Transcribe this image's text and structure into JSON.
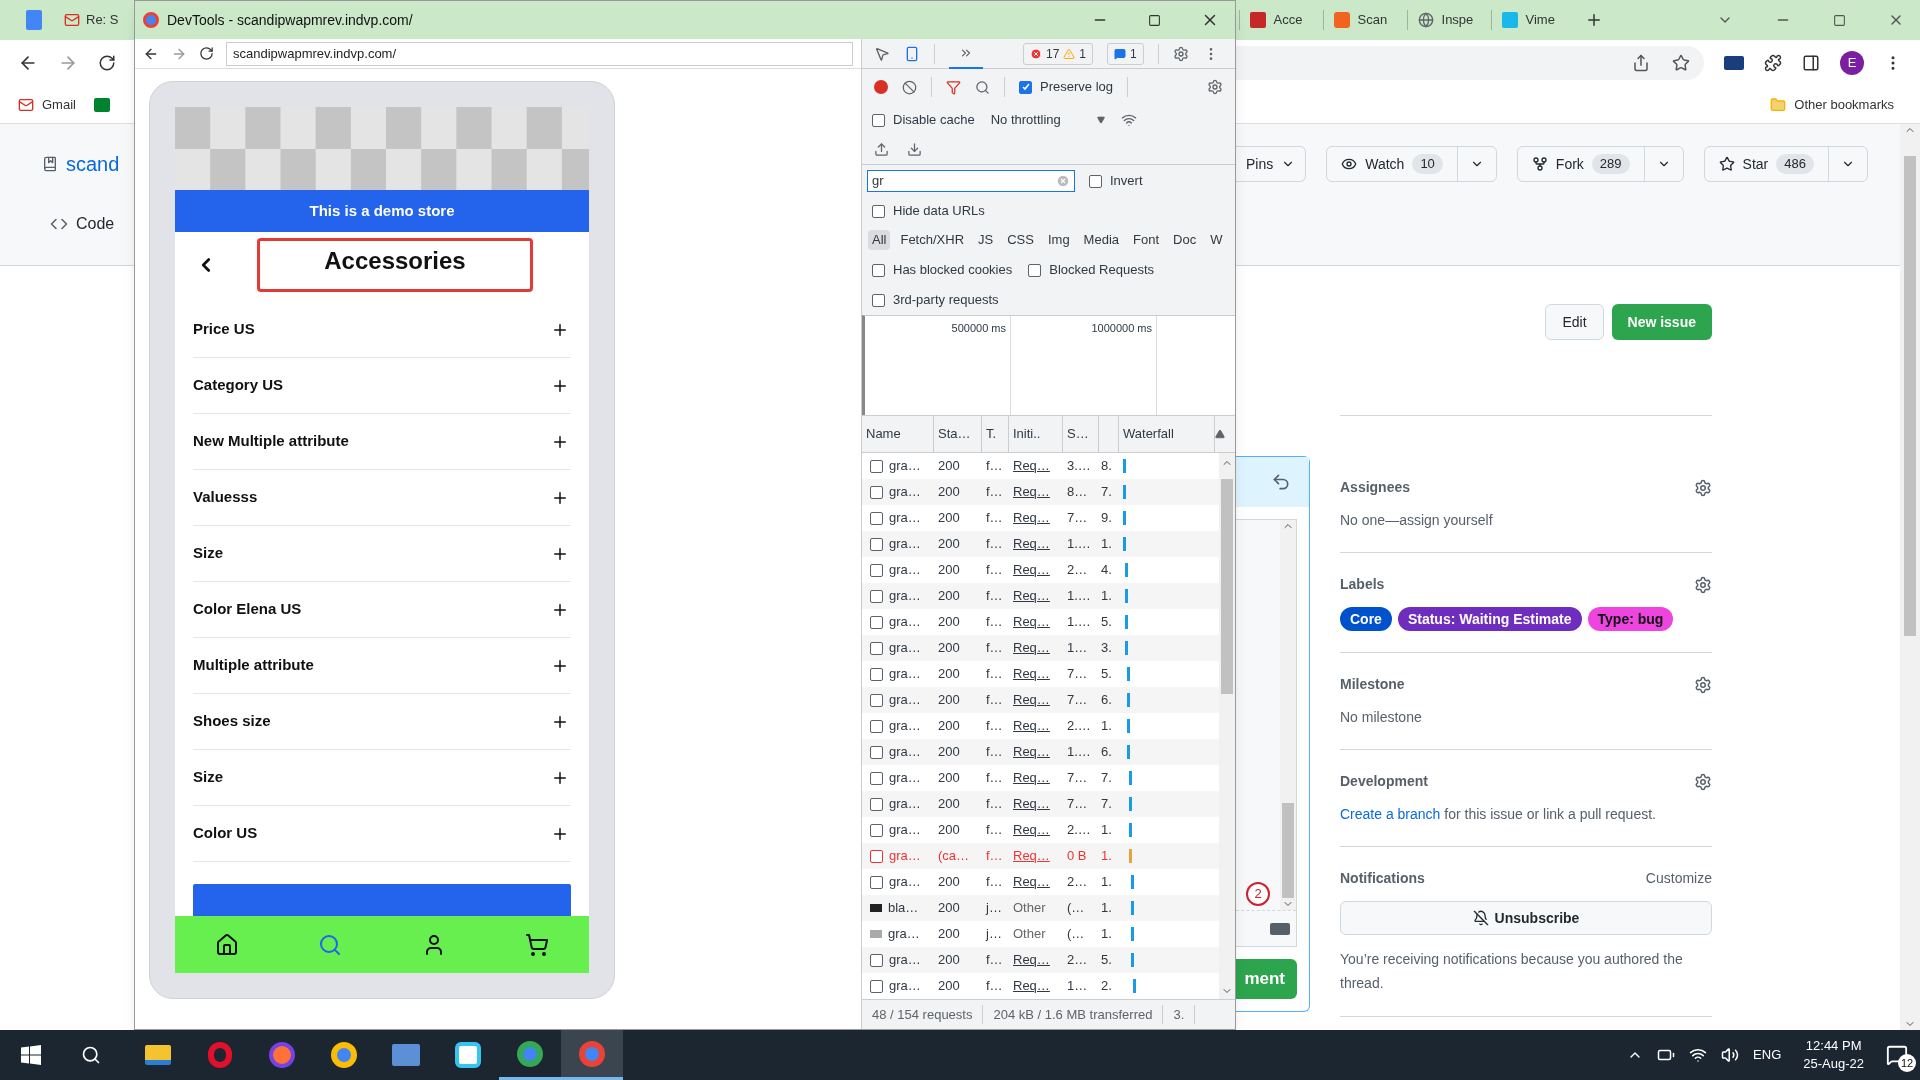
{
  "browser": {
    "left_tabs": [
      {
        "title": "Re: S"
      }
    ],
    "right_tabs": [
      {
        "title": "Acce",
        "kind": "test"
      },
      {
        "title": "Scan",
        "kind": "magento"
      },
      {
        "title": "Inspe",
        "kind": "globe"
      },
      {
        "title": "Vime",
        "kind": "vimeo"
      }
    ],
    "bookmarks": [
      {
        "label": "Gmail"
      }
    ],
    "other_bookmarks": "Other bookmarks",
    "avatar": "E"
  },
  "github": {
    "repo": "scand",
    "nav": "Code",
    "pins": "Pins",
    "counters": [
      {
        "kind": "watch",
        "label": "Watch",
        "count": "10"
      },
      {
        "kind": "fork",
        "label": "Fork",
        "count": "289"
      },
      {
        "kind": "star",
        "label": "Star",
        "count": "486"
      }
    ],
    "edit": "Edit",
    "new_issue": "New issue",
    "comment_button": "ment",
    "badge": "2",
    "sidebar": [
      {
        "kind": "text",
        "title": "Assignees",
        "text": "No one—assign yourself"
      },
      {
        "kind": "labels",
        "title": "Labels",
        "labels": [
          {
            "name": "Core",
            "color": "#0052cc",
            "dark_text": false
          },
          {
            "name": "Status: Waiting Estimate",
            "color": "#6f2dbd",
            "dark_text": false
          },
          {
            "name": "Type: bug",
            "color": "#ee45e0",
            "dark_text": true
          }
        ]
      },
      {
        "kind": "text",
        "title": "Milestone",
        "text": "No milestone"
      },
      {
        "kind": "link",
        "title": "Development",
        "link": "Create a branch",
        "text": "for this issue or link a pull request."
      },
      {
        "kind": "notifications",
        "title": "Notifications",
        "action": "Customize",
        "button": "Unsubscribe",
        "text": "You’re receiving notifications because you authored the thread."
      }
    ]
  },
  "devtools": {
    "title": "DevTools - scandipwapmrev.indvp.com/",
    "url": "scandipwapmrev.indvp.com/",
    "page": {
      "banner": "This is a demo store",
      "heading": "Accessories",
      "filters": [
        {
          "label": "Price US"
        },
        {
          "label": "Category US"
        },
        {
          "label": "New Multiple attribute"
        },
        {
          "label": "Valuesss"
        },
        {
          "label": "Size"
        },
        {
          "label": "Color Elena US"
        },
        {
          "label": "Multiple attribute"
        },
        {
          "label": "Shoes size"
        },
        {
          "label": "Size"
        },
        {
          "label": "Color US"
        }
      ]
    },
    "errors": "17",
    "warnings": "1",
    "messages": "1",
    "preserve_log": {
      "label": "Preserve log",
      "checked": true
    },
    "disable_cache": {
      "label": "Disable cache",
      "checked": false
    },
    "throttling": "No throttling",
    "filter": {
      "value": "gr"
    },
    "invert": {
      "label": "Invert",
      "checked": false
    },
    "hide_data_urls": {
      "label": "Hide data URLs",
      "checked": false
    },
    "type_filters": [
      {
        "label": "All",
        "selected": true
      },
      {
        "label": "Fetch/XHR",
        "selected": false
      },
      {
        "label": "JS",
        "selected": false
      },
      {
        "label": "CSS",
        "selected": false
      },
      {
        "label": "Img",
        "selected": false
      },
      {
        "label": "Media",
        "selected": false
      },
      {
        "label": "Font",
        "selected": false
      },
      {
        "label": "Doc",
        "selected": false
      },
      {
        "label": "W",
        "selected": false
      }
    ],
    "blocked_cookies": {
      "label": "Has blocked cookies",
      "checked": false
    },
    "blocked_requests": {
      "label": "Blocked Requests",
      "checked": false
    },
    "third_party": {
      "label": "3rd-party requests",
      "checked": false
    },
    "overview_ticks": [
      "500000 ms",
      "1000000 ms"
    ],
    "columns": [
      "Name",
      "Sta…",
      "T.",
      "Initi..",
      "S…",
      "Waterfall"
    ],
    "rows": [
      {
        "kind": "fetch",
        "failed": false,
        "name": "gra…",
        "status": "200",
        "type": "f…",
        "initiator": "Req…",
        "size": "3.…",
        "time": "8."
      },
      {
        "kind": "fetch",
        "failed": false,
        "name": "gra…",
        "status": "200",
        "type": "f…",
        "initiator": "Req…",
        "size": "8…",
        "time": "7."
      },
      {
        "kind": "fetch",
        "failed": false,
        "name": "gra…",
        "status": "200",
        "type": "f…",
        "initiator": "Req…",
        "size": "7…",
        "time": "9."
      },
      {
        "kind": "fetch",
        "failed": false,
        "name": "gra…",
        "status": "200",
        "type": "f…",
        "initiator": "Req…",
        "size": "1.…",
        "time": "1."
      },
      {
        "kind": "fetch",
        "failed": false,
        "name": "gra…",
        "status": "200",
        "type": "f…",
        "initiator": "Req…",
        "size": "2…",
        "time": "4."
      },
      {
        "kind": "fetch",
        "failed": false,
        "name": "gra…",
        "status": "200",
        "type": "f…",
        "initiator": "Req…",
        "size": "1.…",
        "time": "1."
      },
      {
        "kind": "fetch",
        "failed": false,
        "name": "gra…",
        "status": "200",
        "type": "f…",
        "initiator": "Req…",
        "size": "1.…",
        "time": "5."
      },
      {
        "kind": "fetch",
        "failed": false,
        "name": "gra…",
        "status": "200",
        "type": "f…",
        "initiator": "Req…",
        "size": "1…",
        "time": "3."
      },
      {
        "kind": "fetch",
        "failed": false,
        "name": "gra…",
        "status": "200",
        "type": "f…",
        "initiator": "Req…",
        "size": "7…",
        "time": "5."
      },
      {
        "kind": "fetch",
        "failed": false,
        "name": "gra…",
        "status": "200",
        "type": "f…",
        "initiator": "Req…",
        "size": "7…",
        "time": "6."
      },
      {
        "kind": "fetch",
        "failed": false,
        "name": "gra…",
        "status": "200",
        "type": "f…",
        "initiator": "Req…",
        "size": "2.…",
        "time": "1."
      },
      {
        "kind": "fetch",
        "failed": false,
        "name": "gra…",
        "status": "200",
        "type": "f…",
        "initiator": "Req…",
        "size": "1.…",
        "time": "6."
      },
      {
        "kind": "fetch",
        "failed": false,
        "name": "gra…",
        "status": "200",
        "type": "f…",
        "initiator": "Req…",
        "size": "7…",
        "time": "7."
      },
      {
        "kind": "fetch",
        "failed": false,
        "name": "gra…",
        "status": "200",
        "type": "f…",
        "initiator": "Req…",
        "size": "7…",
        "time": "7."
      },
      {
        "kind": "fetch",
        "failed": false,
        "name": "gra…",
        "status": "200",
        "type": "f…",
        "initiator": "Req…",
        "size": "2.…",
        "time": "1."
      },
      {
        "kind": "fetch",
        "failed": true,
        "name": "gra…",
        "status": "(ca…",
        "type": "f…",
        "initiator": "Req…",
        "size": "0 B",
        "time": "1."
      },
      {
        "kind": "fetch",
        "failed": false,
        "name": "gra…",
        "status": "200",
        "type": "f…",
        "initiator": "Req…",
        "size": "2…",
        "time": "1."
      },
      {
        "kind": "image",
        "failed": false,
        "name": "bla…",
        "status": "200",
        "type": "j…",
        "initiator": "Other",
        "size": "(…",
        "time": "1."
      },
      {
        "kind": "image",
        "failed": false,
        "name": "gra…",
        "status": "200",
        "type": "j…",
        "initiator": "Other",
        "size": "(…",
        "time": "1."
      },
      {
        "kind": "fetch",
        "failed": false,
        "name": "gra…",
        "status": "200",
        "type": "f…",
        "initiator": "Req…",
        "size": "2…",
        "time": "5."
      },
      {
        "kind": "fetch",
        "failed": false,
        "name": "gra…",
        "status": "200",
        "type": "f…",
        "initiator": "Req…",
        "size": "1…",
        "time": "2."
      }
    ],
    "footer": [
      "48 / 154 requests",
      "204 kB / 1.6 MB transferred",
      "3."
    ]
  },
  "taskbar": {
    "language": "ENG",
    "time": "12:44 PM",
    "date": "25-Aug-22",
    "notifications": "12"
  }
}
